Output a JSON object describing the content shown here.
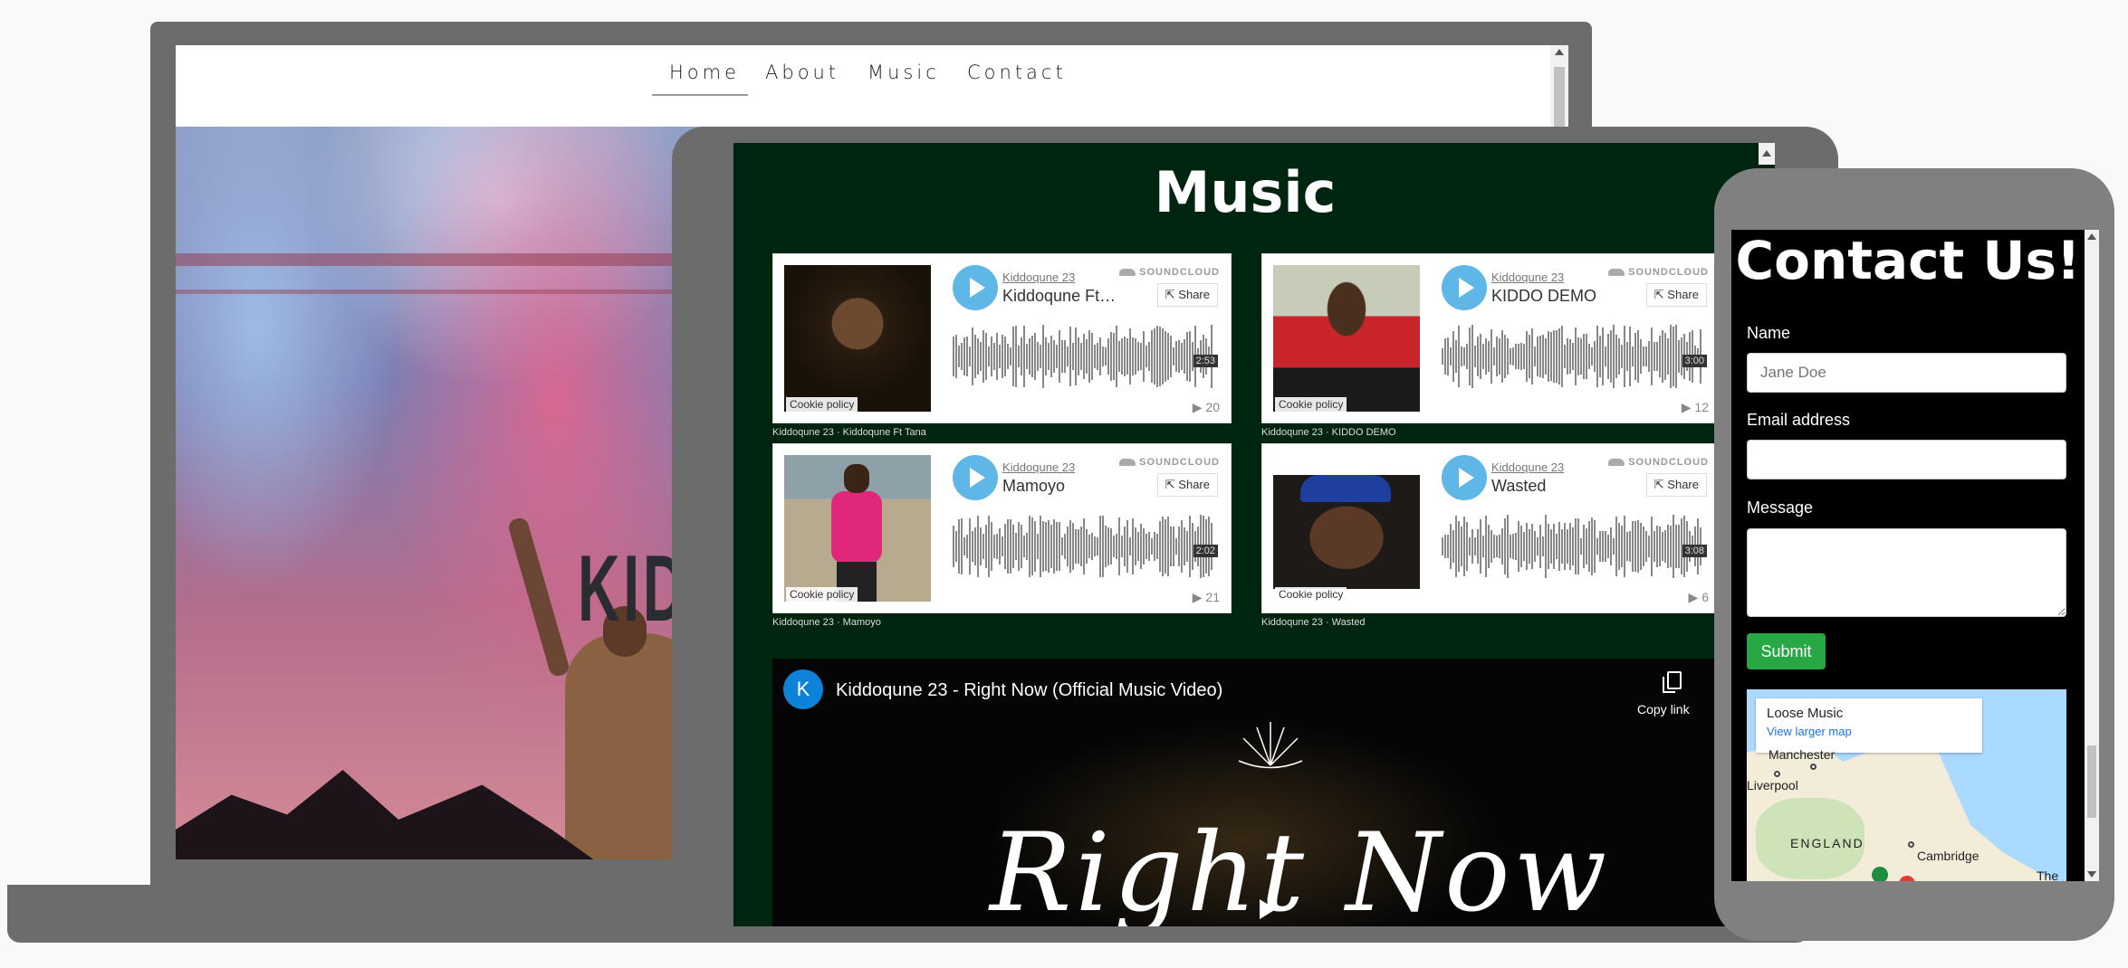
{
  "laptop": {
    "nav": [
      {
        "label": "Home"
      },
      {
        "label": "About"
      },
      {
        "label": "Music"
      },
      {
        "label": "Contact"
      }
    ],
    "hero_text": "KID"
  },
  "tablet": {
    "title": "Music",
    "tracks": [
      {
        "user": "Kiddoqune 23",
        "title": "Kiddoqune Ft…",
        "duration": "2:53",
        "plays": "20",
        "cookie": "Cookie policy",
        "caption": "Kiddoqune 23 · Kiddoqune Ft Tana",
        "share": "Share",
        "brand": "SOUNDCLOUD"
      },
      {
        "user": "Kiddoqune 23",
        "title": "KIDDO DEMO",
        "duration": "3:00",
        "plays": "12",
        "cookie": "Cookie policy",
        "caption": "Kiddoqune 23 · KIDDO DEMO",
        "share": "Share",
        "brand": "SOUNDCLOUD"
      },
      {
        "user": "Kiddoqune 23",
        "title": "Mamoyo",
        "duration": "2:02",
        "plays": "21",
        "cookie": "Cookie policy",
        "caption": "Kiddoqune 23 · Mamoyo",
        "share": "Share",
        "brand": "SOUNDCLOUD"
      },
      {
        "user": "Kiddoqune 23",
        "title": "Wasted",
        "duration": "3:08",
        "plays": "6",
        "cookie": "Cookie policy",
        "caption": "Kiddoqune 23 · Wasted",
        "share": "Share",
        "brand": "SOUNDCLOUD"
      }
    ],
    "video": {
      "avatar_letter": "K",
      "title": "Kiddoqune 23 - Right Now (Official Music Video)",
      "copy_link": "Copy link",
      "script_text": "Right Now"
    }
  },
  "phone": {
    "title": "Contact Us!",
    "name_label": "Name",
    "name_placeholder": "Jane Doe",
    "email_label": "Email address",
    "message_label": "Message",
    "submit_label": "Submit",
    "map": {
      "card_title": "Loose Music",
      "card_link": "View larger map",
      "cities": [
        "Manchester",
        "Liverpool",
        "ENGLAND",
        "Cambridge",
        "The"
      ]
    }
  },
  "colors": {
    "frame": "#6c6c6c",
    "tablet_bg": "#00250f",
    "soundcloud_play": "#5eb7e6",
    "submit_green": "#28a745",
    "youtube_avatar": "#0c83d8"
  }
}
